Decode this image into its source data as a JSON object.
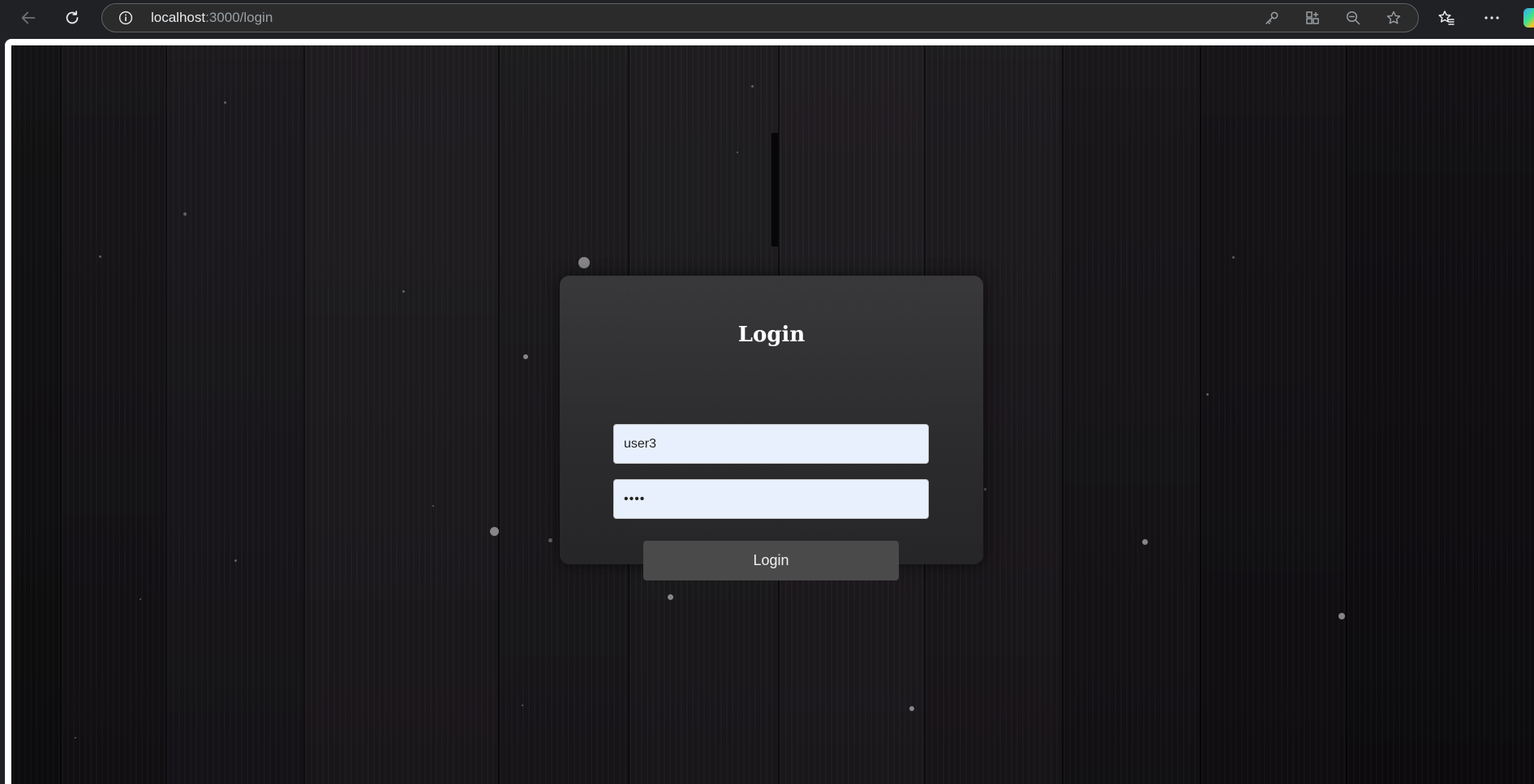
{
  "browser": {
    "url_host": "localhost",
    "url_path": ":3000/login",
    "icons": [
      "back-icon",
      "refresh-icon",
      "info-icon",
      "key-icon",
      "extensions-icon",
      "zoom-out-icon",
      "favorite-star-icon",
      "favorites-icon",
      "more-icon",
      "copilot-icon"
    ]
  },
  "login": {
    "title": "Login",
    "username_value": "user3",
    "password_value": "••••",
    "submit_label": "Login"
  },
  "colors": {
    "background": "#151316",
    "card": "#2e2e30",
    "input_fill": "#e8f0fe",
    "button": "#4a4a4a"
  }
}
